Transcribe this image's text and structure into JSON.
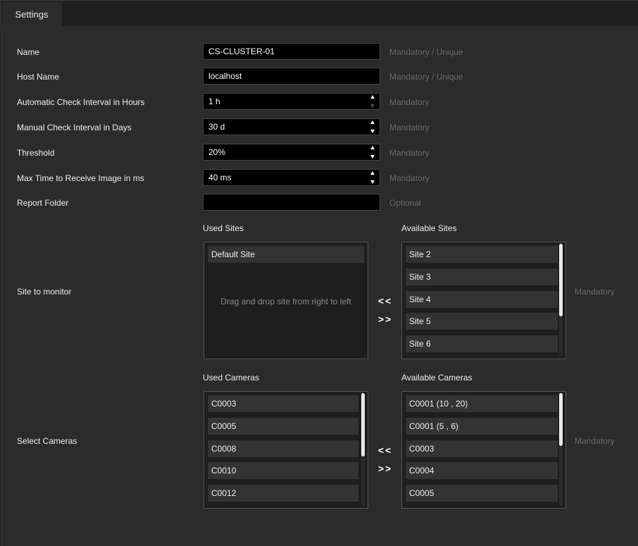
{
  "tab": {
    "label": "Settings"
  },
  "fields": {
    "name": {
      "label": "Name",
      "value": "CS-CLUSTER-01",
      "hint": "Mandatory / Unique"
    },
    "host": {
      "label": "Host Name",
      "value": "localhost",
      "hint": "Mandatory / Unique"
    },
    "auto_interval": {
      "label": "Automatic Check Interval in Hours",
      "value": "1 h",
      "hint": "Mandatory"
    },
    "manual_interval": {
      "label": "Manual Check Interval in Days",
      "value": "30 d",
      "hint": "Mandatory"
    },
    "threshold": {
      "label": "Threshold",
      "value": "20%",
      "hint": "Mandatory"
    },
    "max_time": {
      "label": "Max Time to Receive Image in ms",
      "value": "40 ms",
      "hint": "Mandatory"
    },
    "report_folder": {
      "label": "Report Folder",
      "value": "",
      "hint": "Optional"
    }
  },
  "sites": {
    "label": "Site to monitor",
    "used_label": "Used Sites",
    "available_label": "Available Sites",
    "used": [
      "Default Site"
    ],
    "drop_hint": "Drag and drop site from right to left",
    "available": [
      "Site 2",
      "Site 3",
      "Site 4",
      "Site 5",
      "Site 6"
    ],
    "move_left": "<<",
    "move_right": ">>",
    "hint": "Mandatory"
  },
  "cameras": {
    "label": "Select Cameras",
    "used_label": "Used Cameras",
    "available_label": "Available Cameras",
    "used": [
      "C0003",
      "C0005",
      "C0008",
      "C0010",
      "C0012"
    ],
    "available": [
      "C0001 (10 , 20)",
      "C0001 (5 , 6)",
      "C0003",
      "C0004",
      "C0005"
    ],
    "move_left": "<<",
    "move_right": ">>",
    "hint": "Mandatory"
  }
}
